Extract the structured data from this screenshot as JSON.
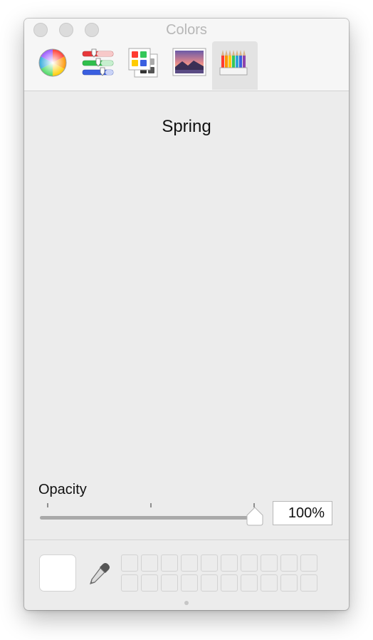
{
  "window": {
    "title": "Colors"
  },
  "toolbar": {
    "tools": [
      {
        "name": "color-wheel",
        "icon": "color-wheel-icon"
      },
      {
        "name": "color-sliders",
        "icon": "sliders-icon"
      },
      {
        "name": "color-palettes",
        "icon": "palettes-icon"
      },
      {
        "name": "image-palettes",
        "icon": "image-icon"
      },
      {
        "name": "pencils",
        "icon": "pencils-icon",
        "selected": true
      }
    ]
  },
  "main": {
    "list_title": "Spring"
  },
  "opacity": {
    "label": "Opacity",
    "value": "100%",
    "level": 1.0
  },
  "current_color": {
    "hex": "#ffffff"
  },
  "favorites": {
    "rows": 2,
    "columns": 10
  }
}
